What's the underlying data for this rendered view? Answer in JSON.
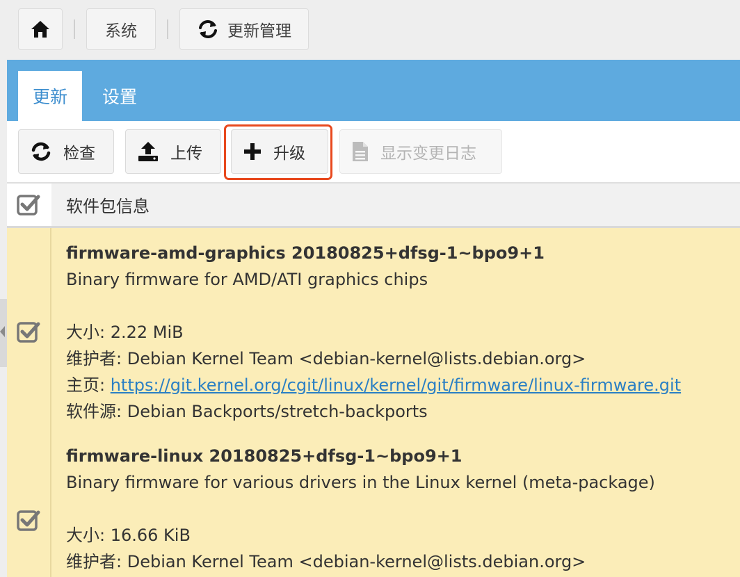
{
  "breadcrumb": {
    "home_icon": "home-icon",
    "system_label": "系统",
    "update_icon": "refresh-icon",
    "update_label": "更新管理"
  },
  "tabs": [
    {
      "label": "更新",
      "active": true
    },
    {
      "label": "设置",
      "active": false
    }
  ],
  "toolbar": {
    "check_label": "检查",
    "upload_label": "上传",
    "upgrade_label": "升级",
    "changelog_label": "显示变更日志",
    "highlight_color": "#e8491e"
  },
  "table": {
    "header_label": "软件包信息"
  },
  "packages": [
    {
      "name": "firmware-amd-graphics 20180825+dfsg-1~bpo9+1",
      "description": "Binary firmware for AMD/ATI graphics chips",
      "size": "大小: 2.22 MiB",
      "maintainer": "维护者: Debian Kernel Team <debian-kernel@lists.debian.org>",
      "homepage_label": "主页: ",
      "homepage_url": "https://git.kernel.org/cgit/linux/kernel/git/firmware/linux-firmware.git",
      "source": "软件源: Debian Backports/stretch-backports",
      "checked": true
    },
    {
      "name": "firmware-linux 20180825+dfsg-1~bpo9+1",
      "description": "Binary firmware for various drivers in the Linux kernel (meta-package)",
      "size": "大小: 16.66 KiB",
      "maintainer": "维护者: Debian Kernel Team <debian-kernel@lists.debian.org>",
      "checked": true
    }
  ],
  "colors": {
    "tabbar": "#5eaadf",
    "active_tab_text": "#3f8fcf",
    "row_bg": "#fbedb8",
    "link": "#2a7fc4"
  }
}
